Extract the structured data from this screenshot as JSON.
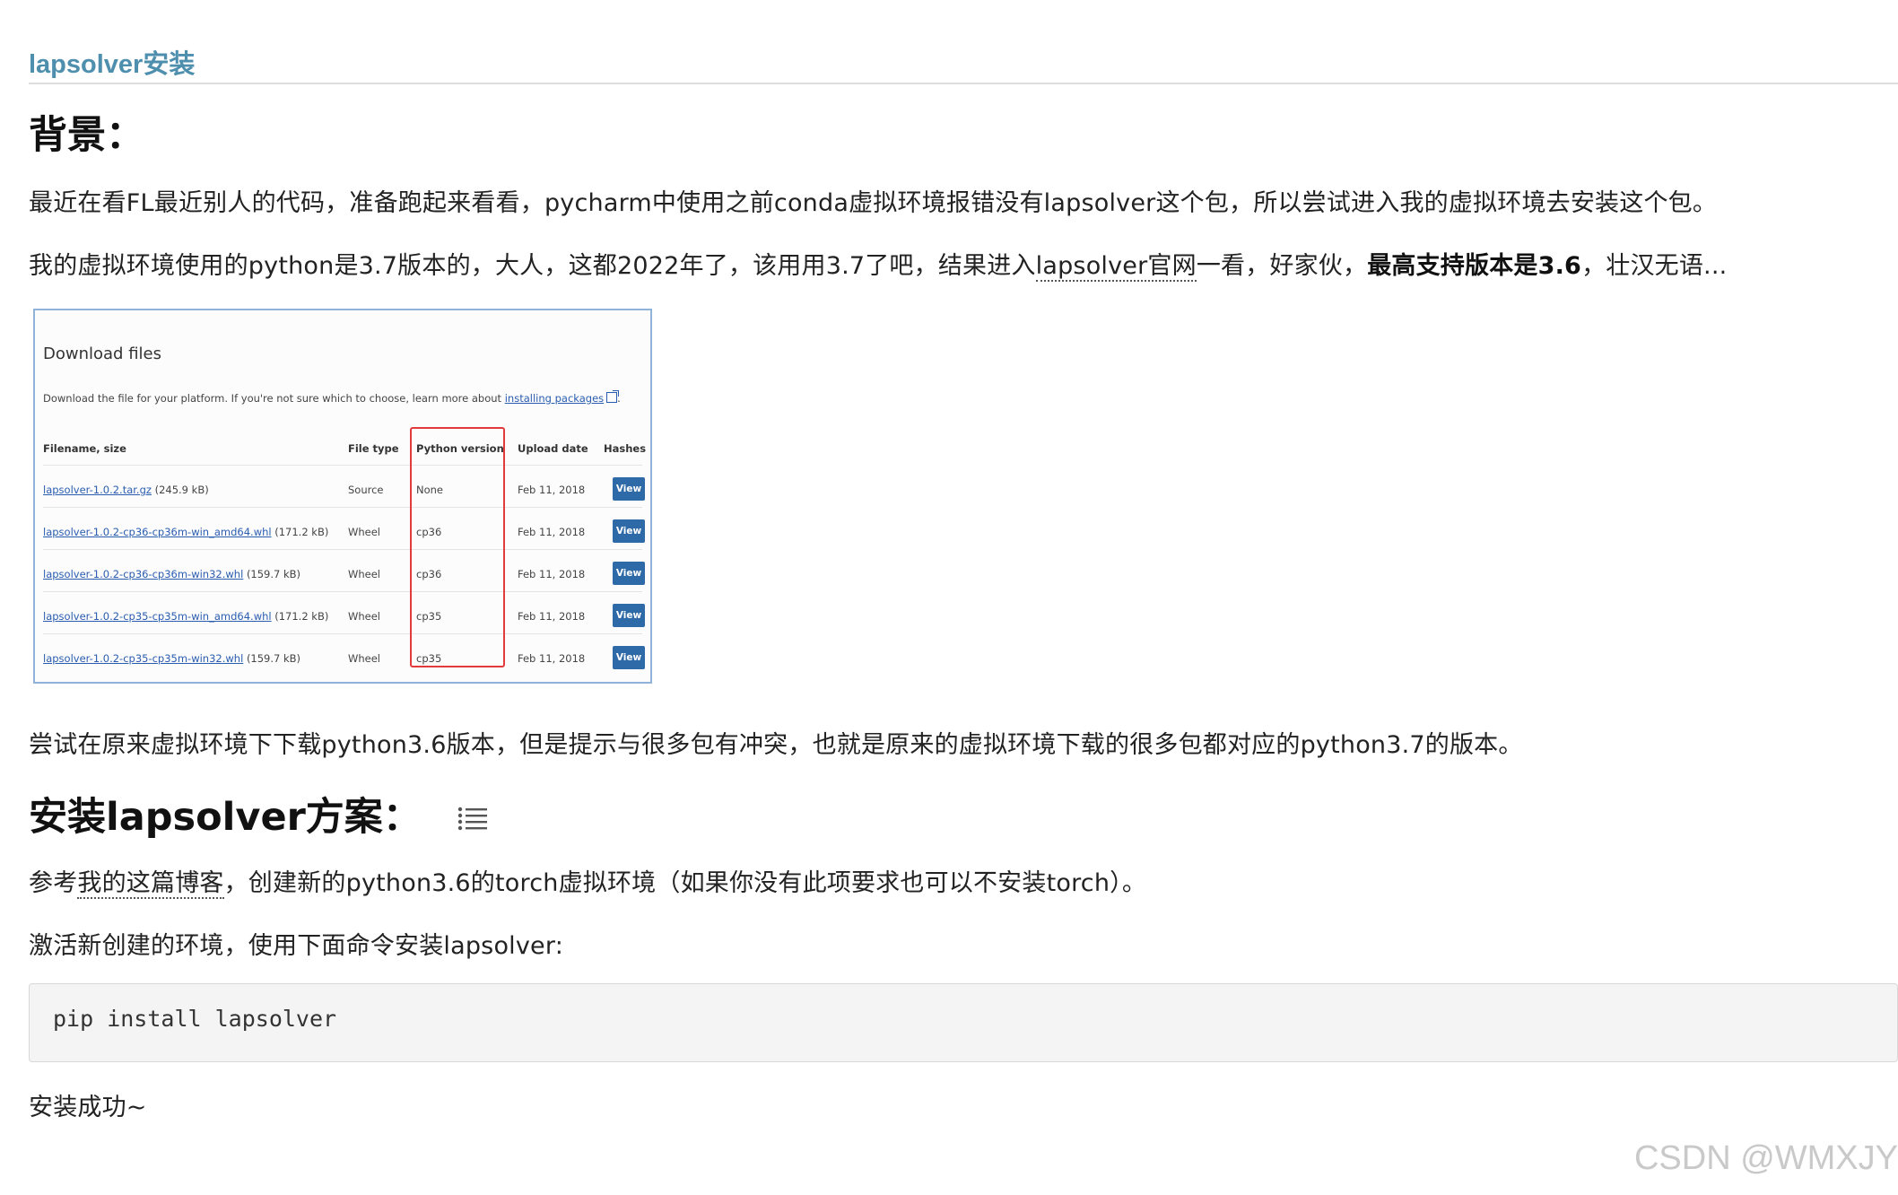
{
  "blog_title": "lapsolver安装",
  "heading_background": "背景：",
  "para1": "最近在看FL最近别人的代码，准备跑起来看看，pycharm中使用之前conda虚拟环境报错没有lapsolver这个包，所以尝试进入我的虚拟环境去安装这个包。",
  "para2": {
    "before": "我的虚拟环境使用的python是3.7版本的，大人，这都2022年了，该用用3.7了吧，结果进入",
    "link": "lapsolver官网",
    "middle": "一看，好家伙，",
    "bold": "最高支持版本是3.6",
    "after": "，壮汉无语..."
  },
  "pypi": {
    "title": "Download files",
    "desc_before": "Download the file for your platform. If you're not sure which to choose, learn more about ",
    "desc_link": "installing packages",
    "desc_after": ".",
    "headers": [
      "Filename, size",
      "File type",
      "Python version",
      "Upload date",
      "Hashes"
    ],
    "rows": [
      {
        "file": "lapsolver-1.0.2.tar.gz",
        "size": "(245.9 kB)",
        "type": "Source",
        "pyver": "None",
        "date": "Feb 11, 2018",
        "hash": "View"
      },
      {
        "file": "lapsolver-1.0.2-cp36-cp36m-win_amd64.whl",
        "size": "(171.2 kB)",
        "type": "Wheel",
        "pyver": "cp36",
        "date": "Feb 11, 2018",
        "hash": "View"
      },
      {
        "file": "lapsolver-1.0.2-cp36-cp36m-win32.whl",
        "size": "(159.7 kB)",
        "type": "Wheel",
        "pyver": "cp36",
        "date": "Feb 11, 2018",
        "hash": "View"
      },
      {
        "file": "lapsolver-1.0.2-cp35-cp35m-win_amd64.whl",
        "size": "(171.2 kB)",
        "type": "Wheel",
        "pyver": "cp35",
        "date": "Feb 11, 2018",
        "hash": "View"
      },
      {
        "file": "lapsolver-1.0.2-cp35-cp35m-win32.whl",
        "size": "(159.7 kB)",
        "type": "Wheel",
        "pyver": "cp35",
        "date": "Feb 11, 2018",
        "hash": "View"
      }
    ],
    "highlight_color": "#e33b3b"
  },
  "para3": "尝试在原来虚拟环境下下载python3.6版本，但是提示与很多包有冲突，也就是原来的虚拟环境下载的很多包都对应的python3.7的版本。",
  "heading_install": "安装lapsolver方案：",
  "toc_icon": "list-icon",
  "para4": {
    "before": "参考",
    "link": "我的这篇博客",
    "after": "，创建新的python3.6的torch虚拟环境（如果你没有此项要求也可以不安装torch）。"
  },
  "para5": "激活新创建的环境，使用下面命令安装lapsolver:",
  "code": "pip install lapsolver",
  "para6": "安装成功~",
  "watermark": "CSDN @WMXJY",
  "colors": {
    "title": "#4f8fae",
    "link": "#2a5db0",
    "button": "#2f6aa8"
  }
}
